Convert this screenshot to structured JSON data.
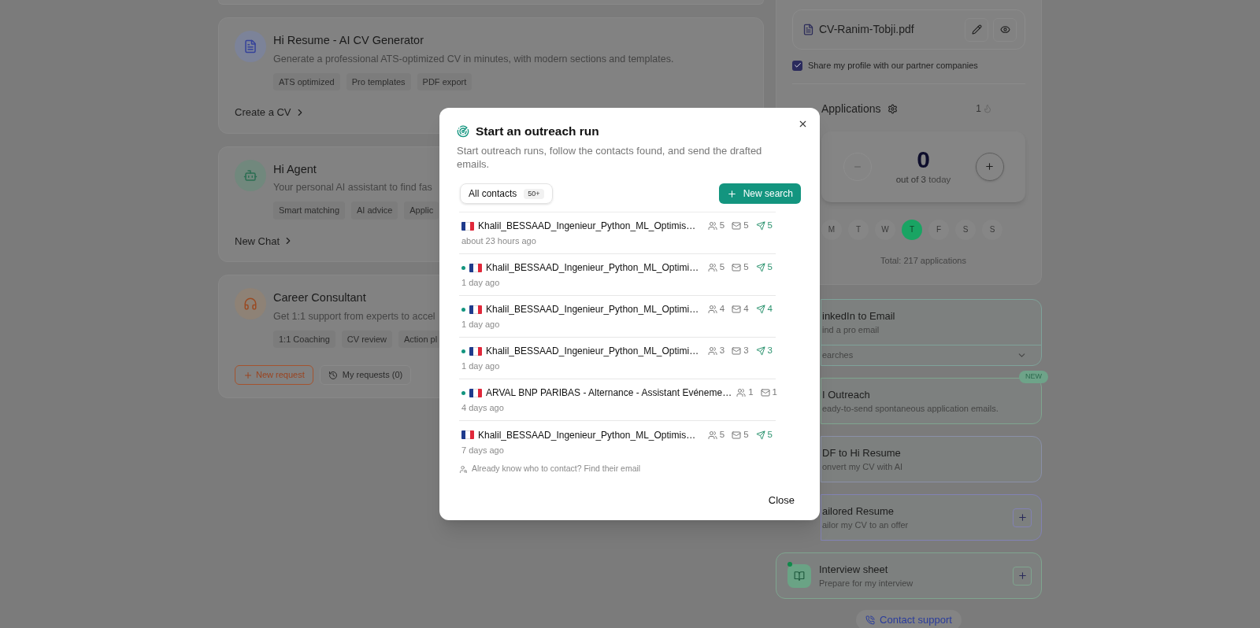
{
  "services": [
    {
      "kind": "document",
      "title": "Hi Resume - AI CV Generator",
      "description": "Generate a professional ATS-optimized CV in minutes, with modern sections and templates.",
      "tags": [
        "ATS optimized",
        "Pro templates",
        "PDF export"
      ],
      "actions": [
        {
          "kind": "link",
          "label": "Create a CV"
        }
      ]
    },
    {
      "kind": "robot",
      "title": "Hi Agent",
      "description": "Your personal AI assistant to find fas",
      "tags": [
        "Smart matching",
        "AI advice",
        "Applic"
      ],
      "actions": [
        {
          "kind": "link",
          "label": "New Chat"
        }
      ]
    },
    {
      "kind": "headset",
      "title": "Career Consultant",
      "description": "Get 1:1 support from experts to accel",
      "tags": [
        "1:1 Coaching",
        "CV review",
        "Action pl"
      ],
      "actions": [
        {
          "kind": "outline",
          "label": "New request"
        },
        {
          "kind": "history",
          "label": "My requests (0)"
        }
      ]
    }
  ],
  "profile": {
    "cv_file": "CV-Ranim-Tobji.pdf",
    "share": {
      "label": "Share my profile with our partner companies",
      "checked": true
    }
  },
  "applications": {
    "title": "Applications",
    "streak": "1",
    "count": "0",
    "goal": "out of 3",
    "goal_suffix": "today",
    "days": [
      {
        "label": "M",
        "selected": false
      },
      {
        "label": "T",
        "selected": false
      },
      {
        "label": "W",
        "selected": false
      },
      {
        "label": "T",
        "selected": true
      },
      {
        "label": "F",
        "selected": false
      },
      {
        "label": "S",
        "selected": false
      },
      {
        "label": "S",
        "selected": false
      }
    ],
    "total": "Total: 217 applications"
  },
  "tools": [
    {
      "kind": "covered",
      "title": "inkedIn to Email",
      "subtitle": "ind a pro email",
      "footer": "earches",
      "expanded": false,
      "color": "#7fa39a"
    },
    {
      "kind": "covered",
      "title": "I Outreach",
      "subtitle": "eady-to-send spontaneous application emails.",
      "badge": "NEW",
      "color": "#7fa58f"
    },
    {
      "kind": "covered",
      "title": "DF to Hi Resume",
      "subtitle": "onvert my CV with AI",
      "color": "#8a90a8"
    },
    {
      "kind": "covered",
      "title": "ailored Resume",
      "subtitle": "ailor my CV to an offer",
      "add_button": true,
      "color": "#8282b4"
    },
    {
      "kind": "book",
      "title": "Interview sheet",
      "subtitle": "Prepare for my interview",
      "add_button": true,
      "color": "#7fa58f"
    }
  ],
  "support_button": "Contact support",
  "modal": {
    "title": "Start an outreach run",
    "description": "Start outreach runs, follow the contacts found, and send the drafted emails.",
    "filter": {
      "label": "All contacts",
      "count": "50+"
    },
    "new_search": "New search",
    "runs": [
      {
        "active": false,
        "name": "Khalil_BESSAAD_Ingenieur_Python_ML_Optimis…",
        "contacts": "5",
        "emails": "5",
        "sent": "5",
        "time": "about 23 hours ago"
      },
      {
        "active": true,
        "name": "Khalil_BESSAAD_Ingenieur_Python_ML_Optimi…",
        "contacts": "5",
        "emails": "5",
        "sent": "5",
        "time": "1 day ago"
      },
      {
        "active": true,
        "name": "Khalil_BESSAAD_Ingenieur_Python_ML_Optimi…",
        "contacts": "4",
        "emails": "4",
        "sent": "4",
        "time": "1 day ago"
      },
      {
        "active": true,
        "name": "Khalil_BESSAAD_Ingenieur_Python_ML_Optimi…",
        "contacts": "3",
        "emails": "3",
        "sent": "3",
        "time": "1 day ago"
      },
      {
        "active": true,
        "name": "ARVAL BNP PARIBAS - Alternance - Assistant Evéneme…",
        "contacts": "1",
        "emails": "1",
        "time": "4 days ago"
      },
      {
        "active": false,
        "name": "Khalil_BESSAAD_Ingenieur_Python_ML_Optimis…",
        "contacts": "5",
        "emails": "5",
        "sent": "5",
        "time": "7 days ago"
      }
    ],
    "find_email_link": "Already know who to contact? Find their email",
    "close_button": "Close"
  }
}
